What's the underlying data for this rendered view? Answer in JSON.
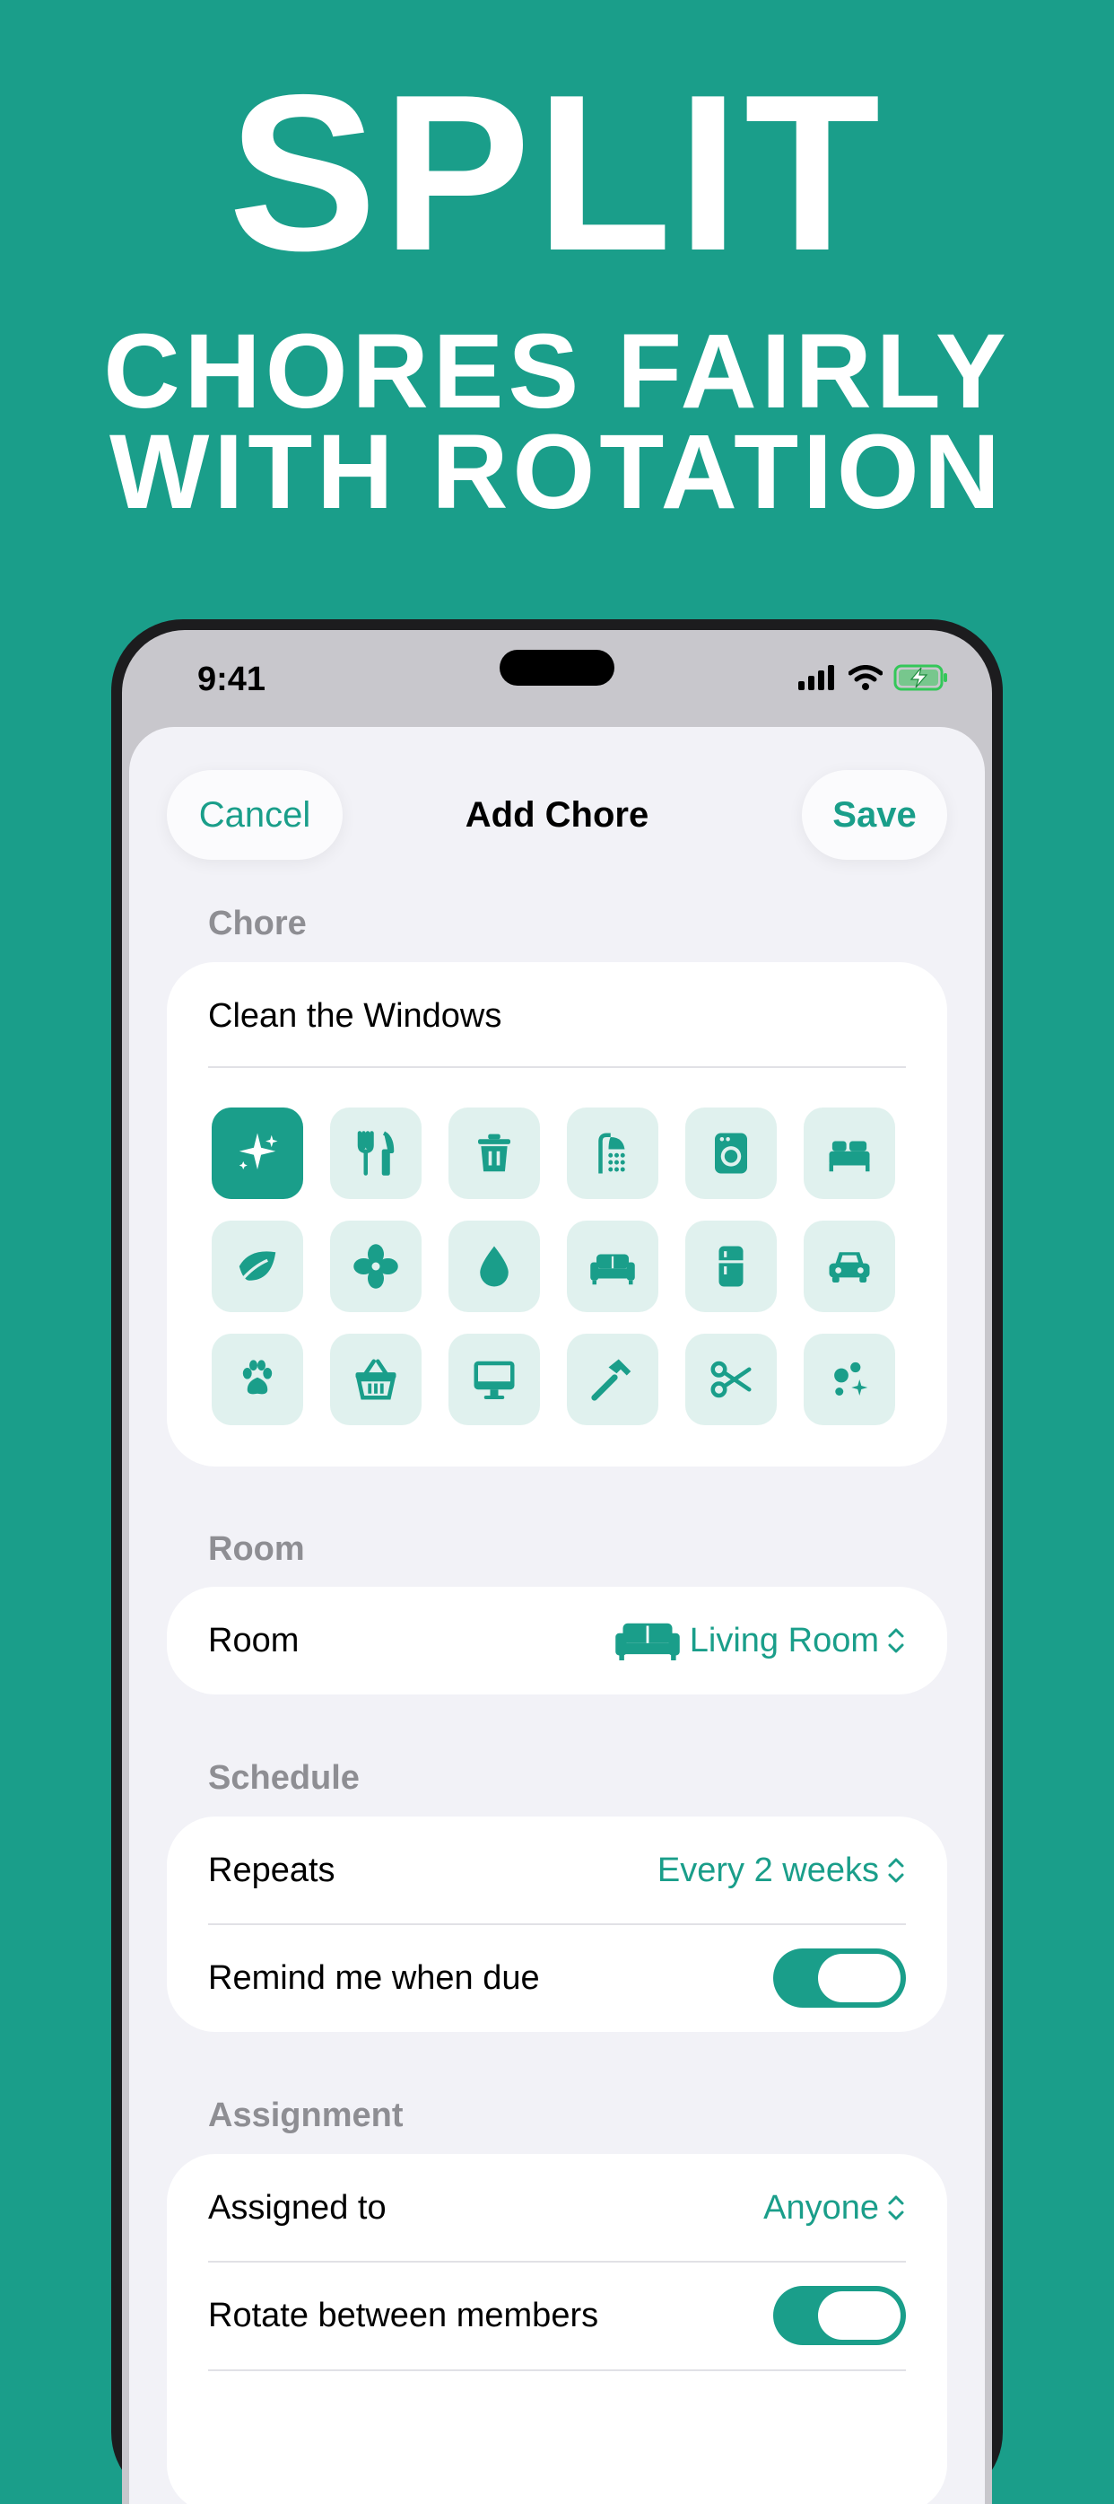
{
  "marketing": {
    "line1": "SPLIT",
    "line2": "CHORES FAIRLY",
    "line3": "WITH ROTATION"
  },
  "status_bar": {
    "time": "9:41"
  },
  "nav": {
    "cancel": "Cancel",
    "title": "Add Chore",
    "save": "Save"
  },
  "chore": {
    "section": "Chore",
    "name_value": "Clean the Windows",
    "selected_icon": "sparkles-icon",
    "icons": [
      "sparkles-icon",
      "fork-knife-icon",
      "trash-icon",
      "shower-icon",
      "washer-icon",
      "bed-icon",
      "leaf-icon",
      "fan-icon",
      "drop-icon",
      "sofa-icon",
      "fridge-icon",
      "car-icon",
      "paw-icon",
      "basket-icon",
      "monitor-icon",
      "hammer-icon",
      "scissors-icon",
      "bubbles-icon"
    ]
  },
  "room": {
    "section": "Room",
    "label": "Room",
    "value": "Living Room",
    "icon": "sofa-icon"
  },
  "schedule": {
    "section": "Schedule",
    "repeats_label": "Repeats",
    "repeats_value": "Every 2 weeks",
    "remind_label": "Remind me when due",
    "remind_on": true
  },
  "assignment": {
    "section": "Assignment",
    "assigned_label": "Assigned to",
    "assigned_value": "Anyone",
    "rotate_label": "Rotate between members",
    "rotate_on": true
  },
  "colors": {
    "brand": "#1a9e8a",
    "tile": "#e0f1ee",
    "sheet": "#f2f2f7"
  }
}
